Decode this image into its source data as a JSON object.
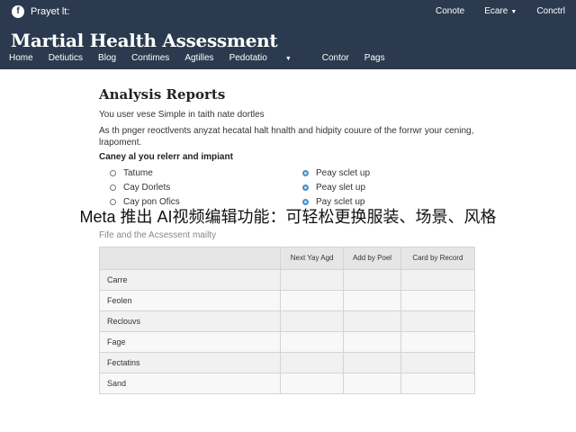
{
  "header": {
    "logo_glyph": "f",
    "project_label": "Prayet lt:",
    "top_links": [
      "Conote",
      "Ecare",
      "Conctrl"
    ],
    "site_title": "Martial Health Assessment",
    "nav": [
      {
        "label": "Home"
      },
      {
        "label": "Detiutics"
      },
      {
        "label": "Blog"
      },
      {
        "label": "Contimes"
      },
      {
        "label": "Agtilles"
      },
      {
        "label": "Pedotatio"
      },
      {
        "label": "Contor"
      },
      {
        "label": "Pags"
      }
    ],
    "background": "#2b3a4e"
  },
  "content": {
    "title": "Analysis Reports",
    "intro": "You user vese Simple in taith nate dortles",
    "description": "As th pnger reoctlvents anyzat hecatal halt hnalth and hidpity couure of the forrwr your cening, lrapoment.",
    "options_heading": "Caney al you relerr and impiant",
    "options_left": [
      {
        "label": "Tatume",
        "selected": false
      },
      {
        "label": "Cay Dorlets",
        "selected": false
      },
      {
        "label": "Cay pon Ofics",
        "selected": false
      }
    ],
    "options_right": [
      {
        "label": "Peay sclet up",
        "selected": true
      },
      {
        "label": "Peay slet up",
        "selected": true
      },
      {
        "label": "Pay sclet up",
        "selected": true
      }
    ]
  },
  "caption": "Meta 推出 AI视频编辑功能：可轻松更换服装、场景、风格",
  "table": {
    "title": "Fife and the Acsessent mailty",
    "headers": [
      "",
      "Next Yay Agd",
      "Add by Poel",
      "Card by Record"
    ],
    "rows": [
      {
        "label": "Carre"
      },
      {
        "label": "Feolen"
      },
      {
        "label": "Reclouvs"
      },
      {
        "label": "Fage"
      },
      {
        "label": "Fectatins"
      },
      {
        "label": "Sand"
      }
    ]
  }
}
